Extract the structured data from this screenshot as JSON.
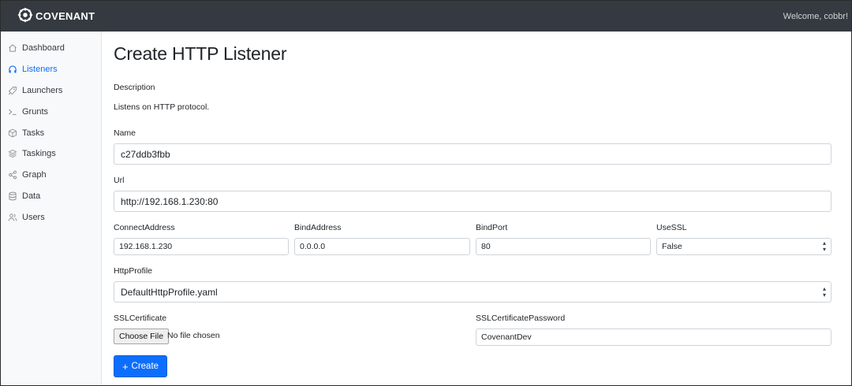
{
  "header": {
    "brand": "COVENANT",
    "welcome": "Welcome, cobbr!"
  },
  "sidebar": {
    "items": [
      {
        "label": "Dashboard",
        "icon": "home-icon",
        "active": false
      },
      {
        "label": "Listeners",
        "icon": "headphones-icon",
        "active": true
      },
      {
        "label": "Launchers",
        "icon": "rocket-icon",
        "active": false
      },
      {
        "label": "Grunts",
        "icon": "terminal-icon",
        "active": false
      },
      {
        "label": "Tasks",
        "icon": "box-icon",
        "active": false
      },
      {
        "label": "Taskings",
        "icon": "layers-icon",
        "active": false
      },
      {
        "label": "Graph",
        "icon": "share-icon",
        "active": false
      },
      {
        "label": "Data",
        "icon": "database-icon",
        "active": false
      },
      {
        "label": "Users",
        "icon": "users-icon",
        "active": false
      }
    ]
  },
  "page": {
    "title": "Create HTTP Listener"
  },
  "form": {
    "description_label": "Description",
    "description_text": "Listens on HTTP protocol.",
    "name_label": "Name",
    "name_value": "c27ddb3fbb",
    "url_label": "Url",
    "url_value": "http://192.168.1.230:80",
    "connect_address_label": "ConnectAddress",
    "connect_address_value": "192.168.1.230",
    "bind_address_label": "BindAddress",
    "bind_address_value": "0.0.0.0",
    "bind_port_label": "BindPort",
    "bind_port_value": "80",
    "use_ssl_label": "UseSSL",
    "use_ssl_value": "False",
    "http_profile_label": "HttpProfile",
    "http_profile_value": "DefaultHttpProfile.yaml",
    "ssl_cert_label": "SSLCertificate",
    "choose_file_label": "Choose File",
    "no_file_text": "No file chosen",
    "ssl_cert_password_label": "SSLCertificatePassword",
    "ssl_cert_password_value": "CovenantDev",
    "create_label": "Create",
    "create_icon": "plus-icon"
  },
  "colors": {
    "accent": "#0d6efd",
    "topbar": "#343a40",
    "sidebar_bg": "#f8f9fa"
  }
}
